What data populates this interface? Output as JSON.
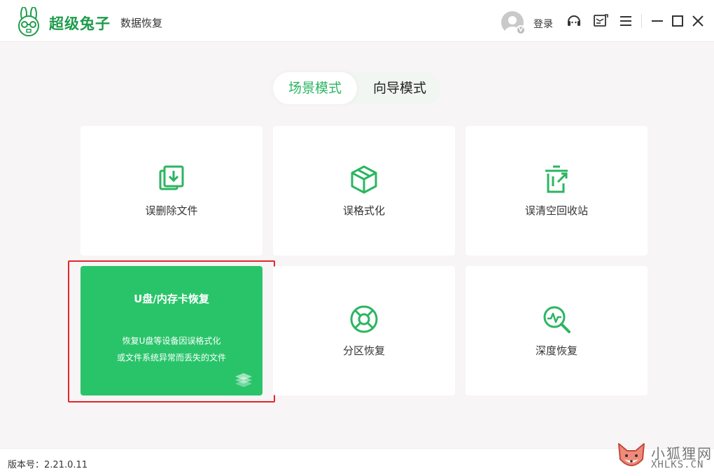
{
  "header": {
    "brand": "超级兔子",
    "subtitle": "数据恢复",
    "avatar_badge": "V",
    "login_label": "登录"
  },
  "icons": {
    "support": "headset-icon",
    "message": "message-icon",
    "menu": "menu-icon",
    "minimize": "minimize-icon",
    "maximize": "maximize-icon",
    "close": "close-icon"
  },
  "mode_tabs": [
    {
      "label": "场景模式",
      "active": true
    },
    {
      "label": "向导模式",
      "active": false
    }
  ],
  "cards": [
    {
      "label": "误删除文件",
      "icon": "file-restore-icon"
    },
    {
      "label": "误格式化",
      "icon": "cube-icon"
    },
    {
      "label": "误清空回收站",
      "icon": "recycle-bin-icon"
    },
    {
      "label": "U盘/内存卡恢复",
      "desc_line1": "恢复U盘等设备因误格式化",
      "desc_line2": "或文件系统异常而丢失的文件",
      "icon": "layers-icon",
      "highlighted": true
    },
    {
      "label": "分区恢复",
      "icon": "partition-icon"
    },
    {
      "label": "深度恢复",
      "icon": "deep-scan-icon"
    }
  ],
  "footer": {
    "version": "版本号：2.21.0.11"
  },
  "watermark": {
    "cn": "小狐狸网",
    "en": "XHLKS.CN"
  },
  "colors": {
    "accent": "#29c46a",
    "brand": "#1f9c4c",
    "highlight": "#e0272b"
  }
}
